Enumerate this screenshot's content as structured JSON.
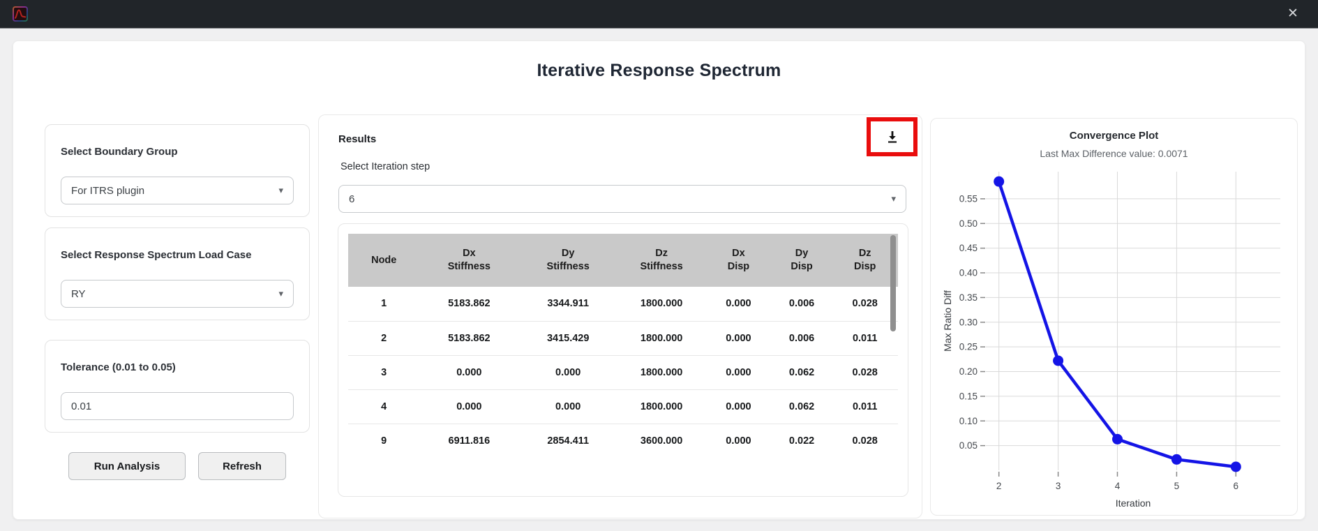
{
  "window": {
    "icons": {
      "close": "✕",
      "caret": "▾"
    }
  },
  "app": {
    "title": "Iterative Response Spectrum"
  },
  "left_panel": {
    "boundary_group": {
      "label": "Select Boundary Group",
      "value": "For ITRS plugin"
    },
    "load_case": {
      "label": "Select Response Spectrum Load Case",
      "value": "RY"
    },
    "tolerance": {
      "label": "Tolerance (0.01 to 0.05)",
      "value": "0.01"
    },
    "buttons": {
      "run": "Run Analysis",
      "refresh": "Refresh"
    }
  },
  "results_panel": {
    "title": "Results",
    "iteration_label": "Select Iteration step",
    "iteration_value": "6",
    "table": {
      "headers": [
        [
          "Node",
          ""
        ],
        [
          "Dx",
          "Stiffness"
        ],
        [
          "Dy",
          "Stiffness"
        ],
        [
          "Dz",
          "Stiffness"
        ],
        [
          "Dx",
          "Disp"
        ],
        [
          "Dy",
          "Disp"
        ],
        [
          "Dz",
          "Disp"
        ]
      ],
      "rows": [
        [
          "1",
          "5183.862",
          "3344.911",
          "1800.000",
          "0.000",
          "0.006",
          "0.028"
        ],
        [
          "2",
          "5183.862",
          "3415.429",
          "1800.000",
          "0.000",
          "0.006",
          "0.011"
        ],
        [
          "3",
          "0.000",
          "0.000",
          "1800.000",
          "0.000",
          "0.062",
          "0.028"
        ],
        [
          "4",
          "0.000",
          "0.000",
          "1800.000",
          "0.000",
          "0.062",
          "0.011"
        ],
        [
          "9",
          "6911.816",
          "2854.411",
          "3600.000",
          "0.000",
          "0.022",
          "0.028"
        ]
      ]
    }
  },
  "chart_data": {
    "type": "line",
    "title": "Convergence Plot",
    "subtitle": "Last Max Difference value: 0.0071",
    "last_max_difference": 0.0071,
    "xlabel": "Iteration",
    "ylabel": "Max Ratio Diff",
    "x": [
      2,
      3,
      4,
      5,
      6
    ],
    "y": [
      0.585,
      0.222,
      0.063,
      0.022,
      0.0071
    ],
    "xlim": [
      1.78,
      6.75
    ],
    "ylim": [
      0,
      0.605
    ],
    "x_ticks": [
      2,
      3,
      4,
      5,
      6
    ],
    "y_ticks": [
      0.05,
      0.1,
      0.15,
      0.2,
      0.25,
      0.3,
      0.35,
      0.4,
      0.45,
      0.5,
      0.55
    ],
    "grid": true,
    "legend": "none",
    "line_color": "#1414e6",
    "marker": "circle"
  },
  "colors": {
    "annotation_red": "#e90d0d",
    "titlebar": "#212529",
    "table_header_gray": "#c9c9c9",
    "grid_gray": "#d9d9d9"
  }
}
